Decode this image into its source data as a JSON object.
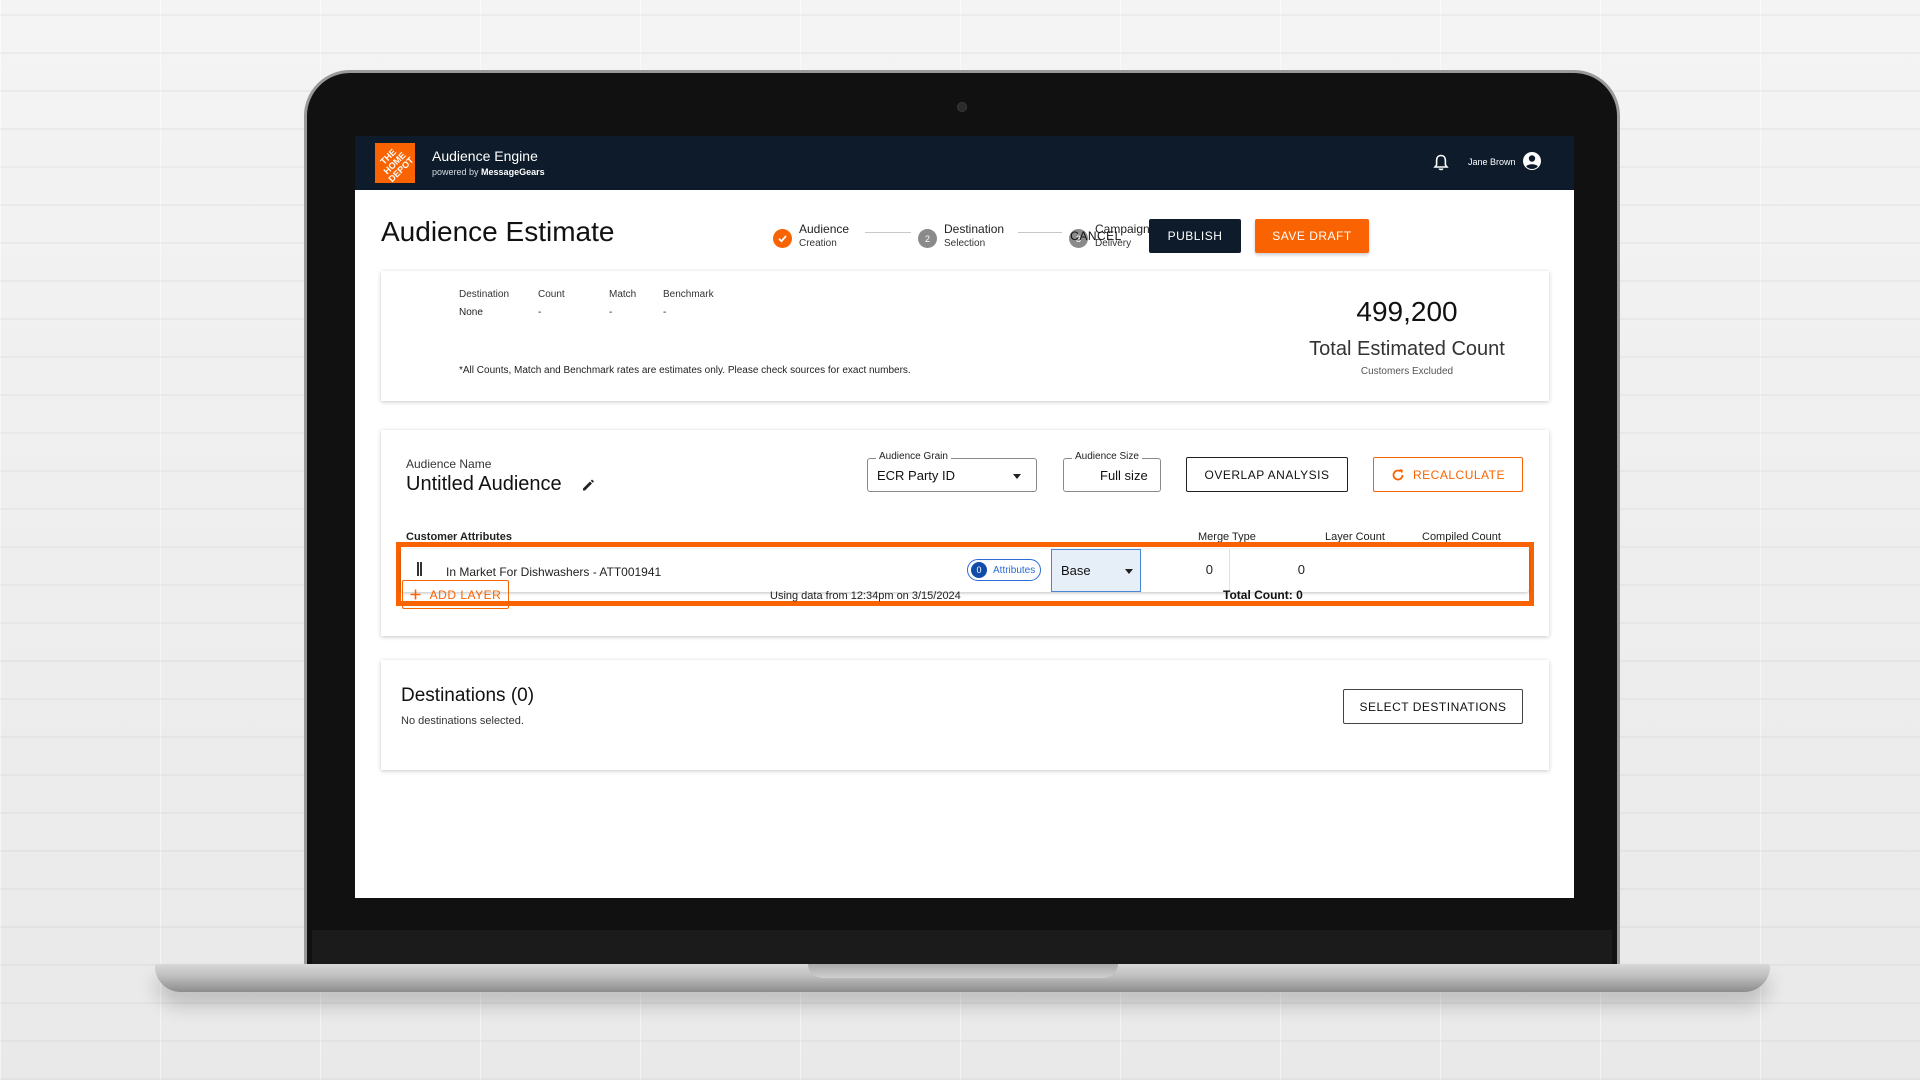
{
  "header": {
    "logo_text": "THE HOME DEPOT",
    "app_title": "Audience Engine",
    "powered_by": "powered by",
    "powered_brand": "MessageGears",
    "user_name": "Jane Brown"
  },
  "page": {
    "title": "Audience Estimate"
  },
  "steps": [
    {
      "title": "Audience",
      "sub": "Creation",
      "status": "done"
    },
    {
      "number": "2",
      "title": "Destination",
      "sub": "Selection",
      "status": "pending"
    },
    {
      "number": "3",
      "title": "Campaign",
      "sub": "Delivery",
      "status": "pending"
    }
  ],
  "actions": {
    "cancel": "CANCEL",
    "publish": "PUBLISH",
    "save_draft": "SAVE DRAFT"
  },
  "estimate": {
    "headers": [
      "Destination",
      "Count",
      "Match",
      "Benchmark"
    ],
    "values": [
      "None",
      "-",
      "-",
      "-"
    ],
    "note": "*All Counts, Match and Benchmark rates are estimates only. Please check sources for exact numbers.",
    "total_value": "499,200",
    "total_label": "Total Estimated Count",
    "total_sub": "Customers Excluded"
  },
  "audience": {
    "name_label": "Audience Name",
    "name": "Untitled Audience",
    "grain_label": "Audience Grain",
    "grain_value": "ECR Party ID",
    "size_label": "Audience Size",
    "size_value": "Full size",
    "overlap_button": "OVERLAP ANALYSIS",
    "recalculate_button": "RECALCULATE",
    "columns": {
      "attributes": "Customer Attributes",
      "merge_type": "Merge Type",
      "layer_count": "Layer Count",
      "compiled_count": "Compiled Count"
    },
    "layers": [
      {
        "attribute": "In Market For Dishwashers - ATT001941",
        "attr_count": "0",
        "attr_label": "Attributes",
        "merge_type": "Base",
        "layer_count": "0",
        "compiled_count": "0"
      }
    ],
    "add_layer": "ADD LAYER",
    "using_data": "Using data from 12:34pm on 3/15/2024",
    "total_count": "Total Count: 0"
  },
  "destinations": {
    "title": "Destinations (0)",
    "empty_text": "No destinations selected.",
    "select_button": "SELECT DESTINATIONS"
  },
  "colors": {
    "brand_orange": "#f96302",
    "header_navy": "#0d1b2a",
    "link_blue": "#2b6cd6"
  }
}
